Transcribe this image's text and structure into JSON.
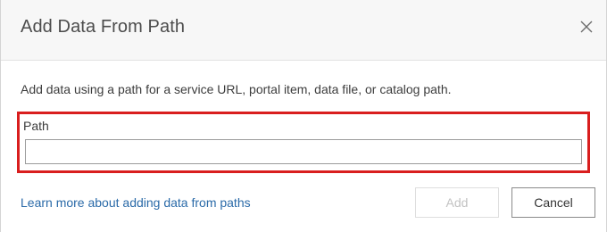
{
  "dialog": {
    "title": "Add Data From Path",
    "close_icon": "close-icon",
    "description": "Add data using a path for a service URL, portal item, data file, or catalog path.",
    "path_label": "Path",
    "path_value": "",
    "path_placeholder": "",
    "learn_more_link": "Learn more about adding data from paths",
    "add_button": "Add",
    "cancel_button": "Cancel"
  },
  "colors": {
    "highlight_border": "#d91e1e",
    "link": "#2a6aa8",
    "disabled_text": "#c2c2c2"
  }
}
